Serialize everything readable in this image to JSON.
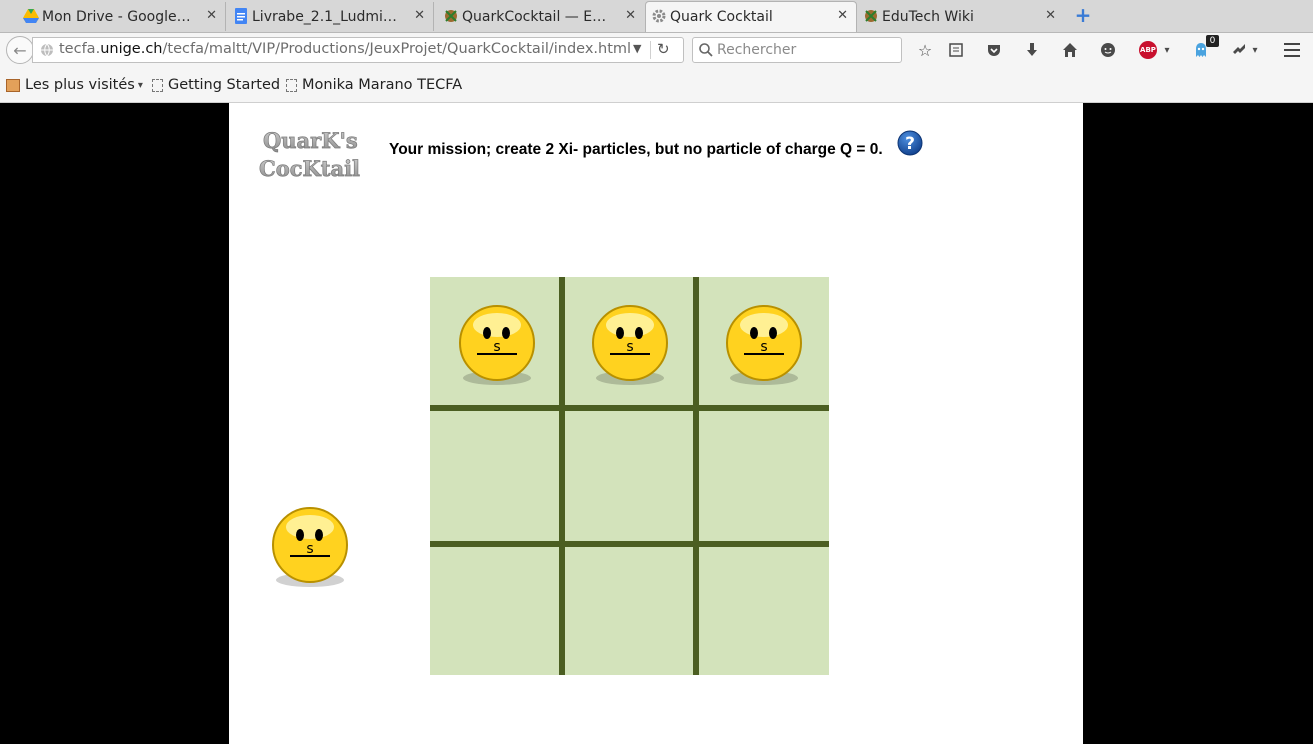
{
  "tabs": [
    {
      "label": "Mon Drive - Google ...",
      "icon": "google-drive-icon"
    },
    {
      "label": "Livrabe_2.1_Ludmil...",
      "icon": "google-docs-icon"
    },
    {
      "label": "QuarkCocktail — Ed...",
      "icon": "edutech-wiki-icon"
    },
    {
      "label": "Quark Cocktail",
      "icon": "loading-gear-icon",
      "active": true
    },
    {
      "label": "EduTech Wiki",
      "icon": "edutech-wiki-icon"
    }
  ],
  "navbar": {
    "url_prefix": "tecfa.",
    "url_domain": "unige.ch",
    "url_path": "/tecfa/maltt/VIP/Productions/JeuxProjet/QuarkCocktail/index.html",
    "search_placeholder": "Rechercher",
    "notification_count": "0"
  },
  "bookmarks": [
    {
      "label": "Les plus visités",
      "icon": "folder-icon"
    },
    {
      "label": "Getting Started",
      "icon": "page-icon"
    },
    {
      "label": "Monika Marano TECFA",
      "icon": "page-icon"
    }
  ],
  "game": {
    "logo_line1": "QuarK's",
    "logo_line2": "CocKtail",
    "mission": "Your mission; create 2 Xi- particles, but no particle of charge Q = 0.",
    "help": "?",
    "quark_label": "s",
    "grid": [
      [
        "s",
        "s",
        "s"
      ],
      [
        "",
        "",
        ""
      ],
      [
        "",
        "",
        ""
      ]
    ],
    "spare_quark": "s"
  },
  "colors": {
    "board_bg": "#d3e3bb",
    "grid_lines": "#4b5e21",
    "quark_yellow": "#ffd21f",
    "help_blue": "#1d5fb0"
  }
}
